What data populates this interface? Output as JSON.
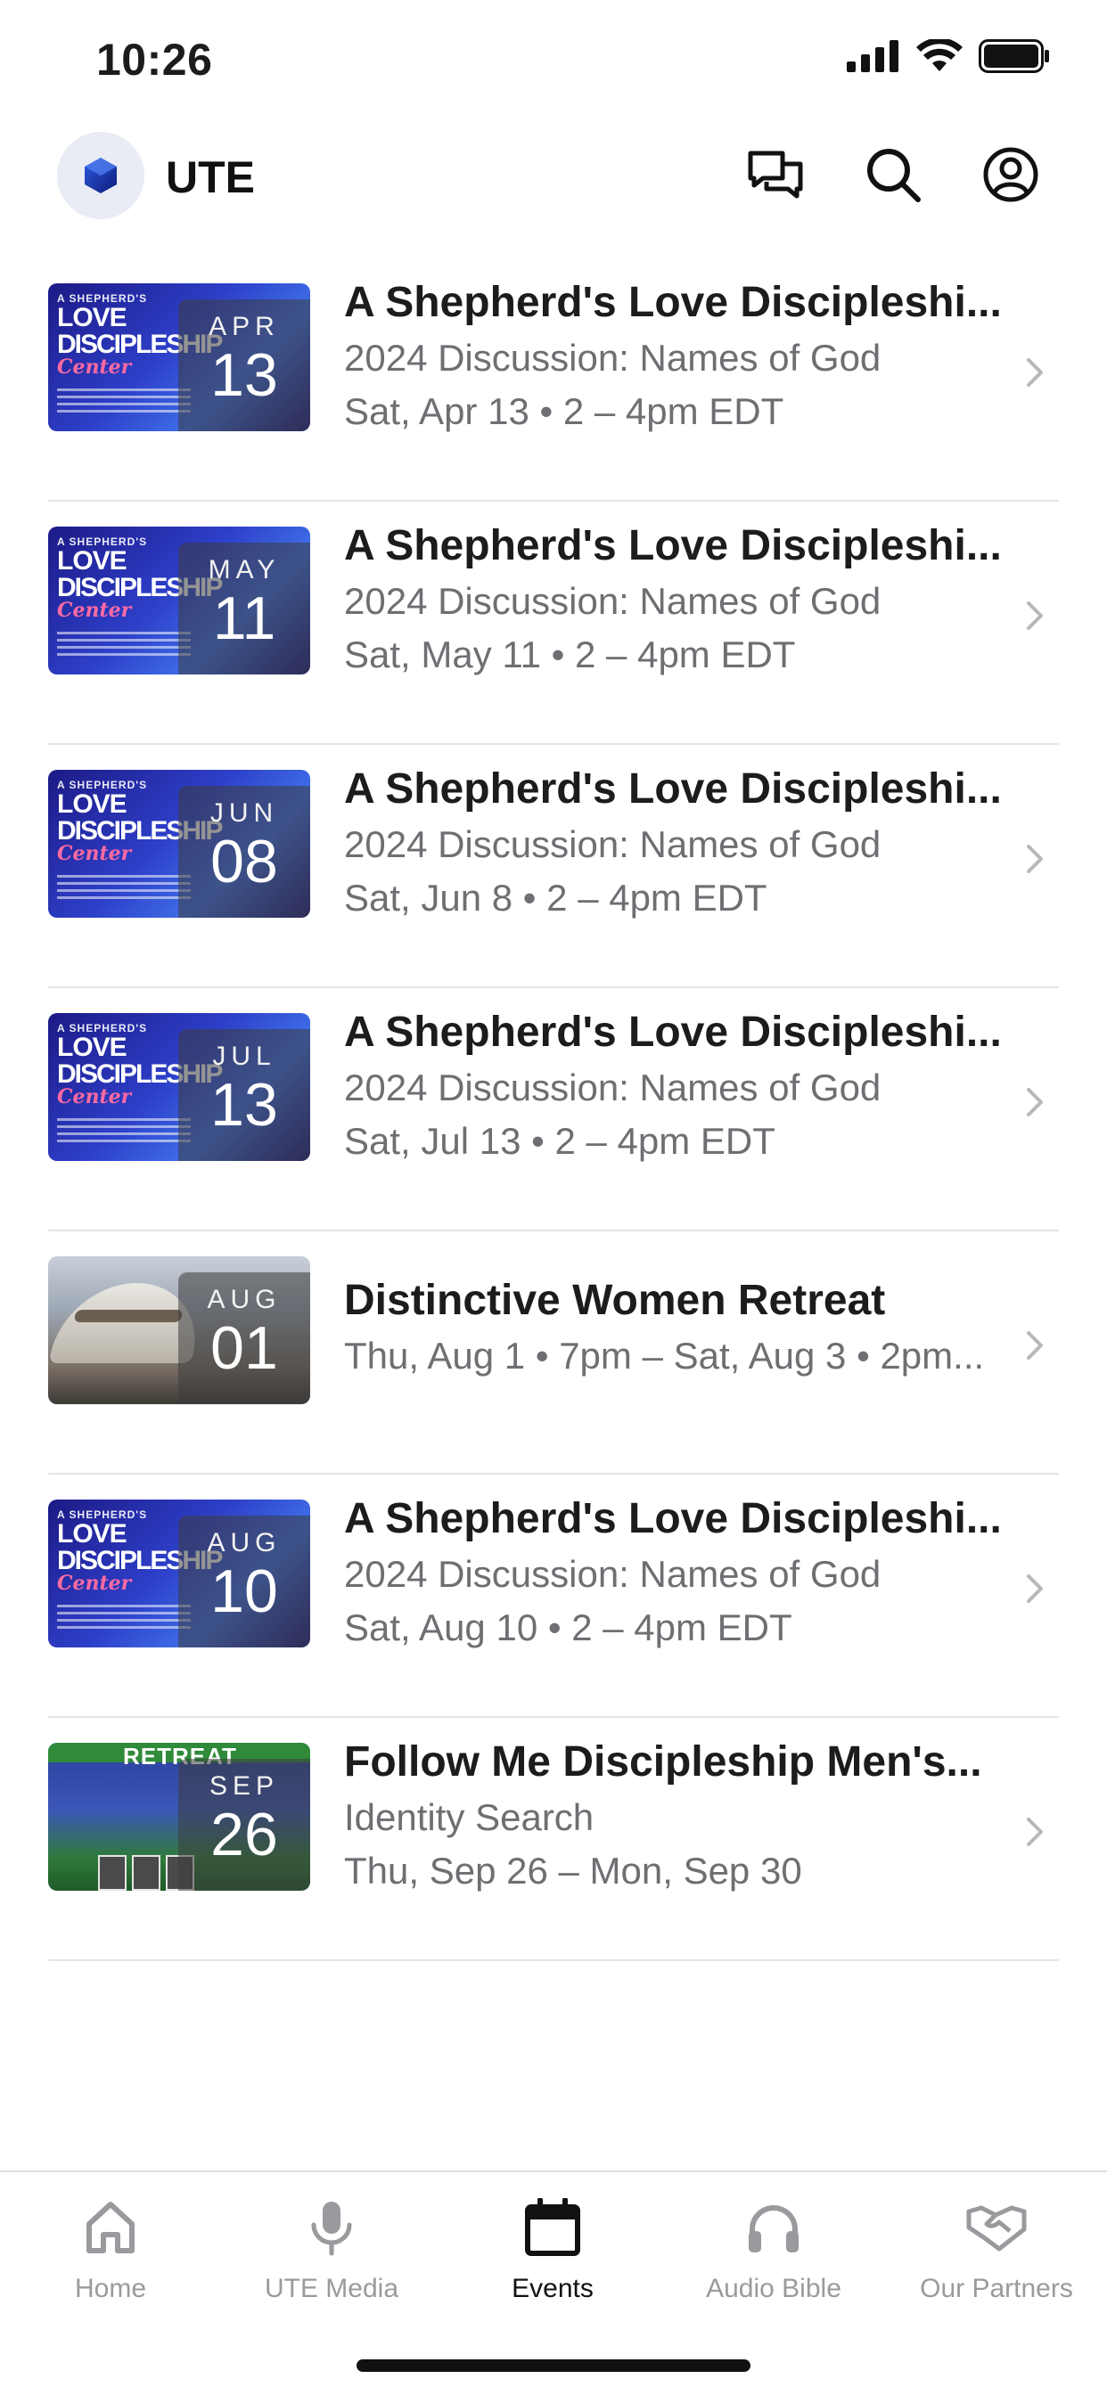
{
  "status_bar": {
    "time": "10:26"
  },
  "header": {
    "app_title": "UTE"
  },
  "events": [
    {
      "month": "APR",
      "day": "13",
      "title": "A Shepherd's Love Discipleshi...",
      "subtitle": "2024 Discussion: Names of God",
      "when": "Sat, Apr 13 • 2 – 4pm EDT",
      "art": "blue"
    },
    {
      "month": "MAY",
      "day": "11",
      "title": "A Shepherd's Love Discipleshi...",
      "subtitle": "2024 Discussion: Names of God",
      "when": "Sat, May 11 • 2 – 4pm EDT",
      "art": "blue"
    },
    {
      "month": "JUN",
      "day": "08",
      "title": "A Shepherd's Love Discipleshi...",
      "subtitle": "2024 Discussion: Names of God",
      "when": "Sat, Jun 8 • 2 – 4pm EDT",
      "art": "blue"
    },
    {
      "month": "JUL",
      "day": "13",
      "title": "A Shepherd's Love Discipleshi...",
      "subtitle": "2024 Discussion: Names of God",
      "when": "Sat, Jul 13 • 2 – 4pm EDT",
      "art": "blue"
    },
    {
      "month": "AUG",
      "day": "01",
      "title": "Distinctive Women Retreat",
      "subtitle": "",
      "when": "Thu, Aug 1 • 7pm – Sat, Aug 3 • 2pm...",
      "art": "retreat"
    },
    {
      "month": "AUG",
      "day": "10",
      "title": "A Shepherd's Love Discipleshi...",
      "subtitle": "2024 Discussion: Names of God",
      "when": "Sat, Aug 10 • 2 – 4pm EDT",
      "art": "blue"
    },
    {
      "month": "SEP",
      "day": "26",
      "title": "Follow Me Discipleship Men's...",
      "subtitle": "Identity Search",
      "when": "Thu, Sep 26 – Mon, Sep 30",
      "art": "men"
    }
  ],
  "thumb_art": {
    "blue_line1": "A SHEPHERD'S",
    "blue_love": "LOVE",
    "blue_disc": "DISCIPLESHIP",
    "blue_center": "Center",
    "men_word": "RETREAT"
  },
  "tabs": [
    {
      "label": "Home",
      "icon": "home-icon",
      "active": false
    },
    {
      "label": "UTE Media",
      "icon": "microphone-icon",
      "active": false
    },
    {
      "label": "Events",
      "icon": "calendar-icon",
      "active": true
    },
    {
      "label": "Audio Bible",
      "icon": "headphones-icon",
      "active": false
    },
    {
      "label": "Our Partners",
      "icon": "handshake-icon",
      "active": false
    }
  ],
  "colors": {
    "accent": "#111111",
    "muted": "#6e6e73",
    "tab_inactive": "#9a9a9e",
    "divider": "#e4e4e6"
  }
}
